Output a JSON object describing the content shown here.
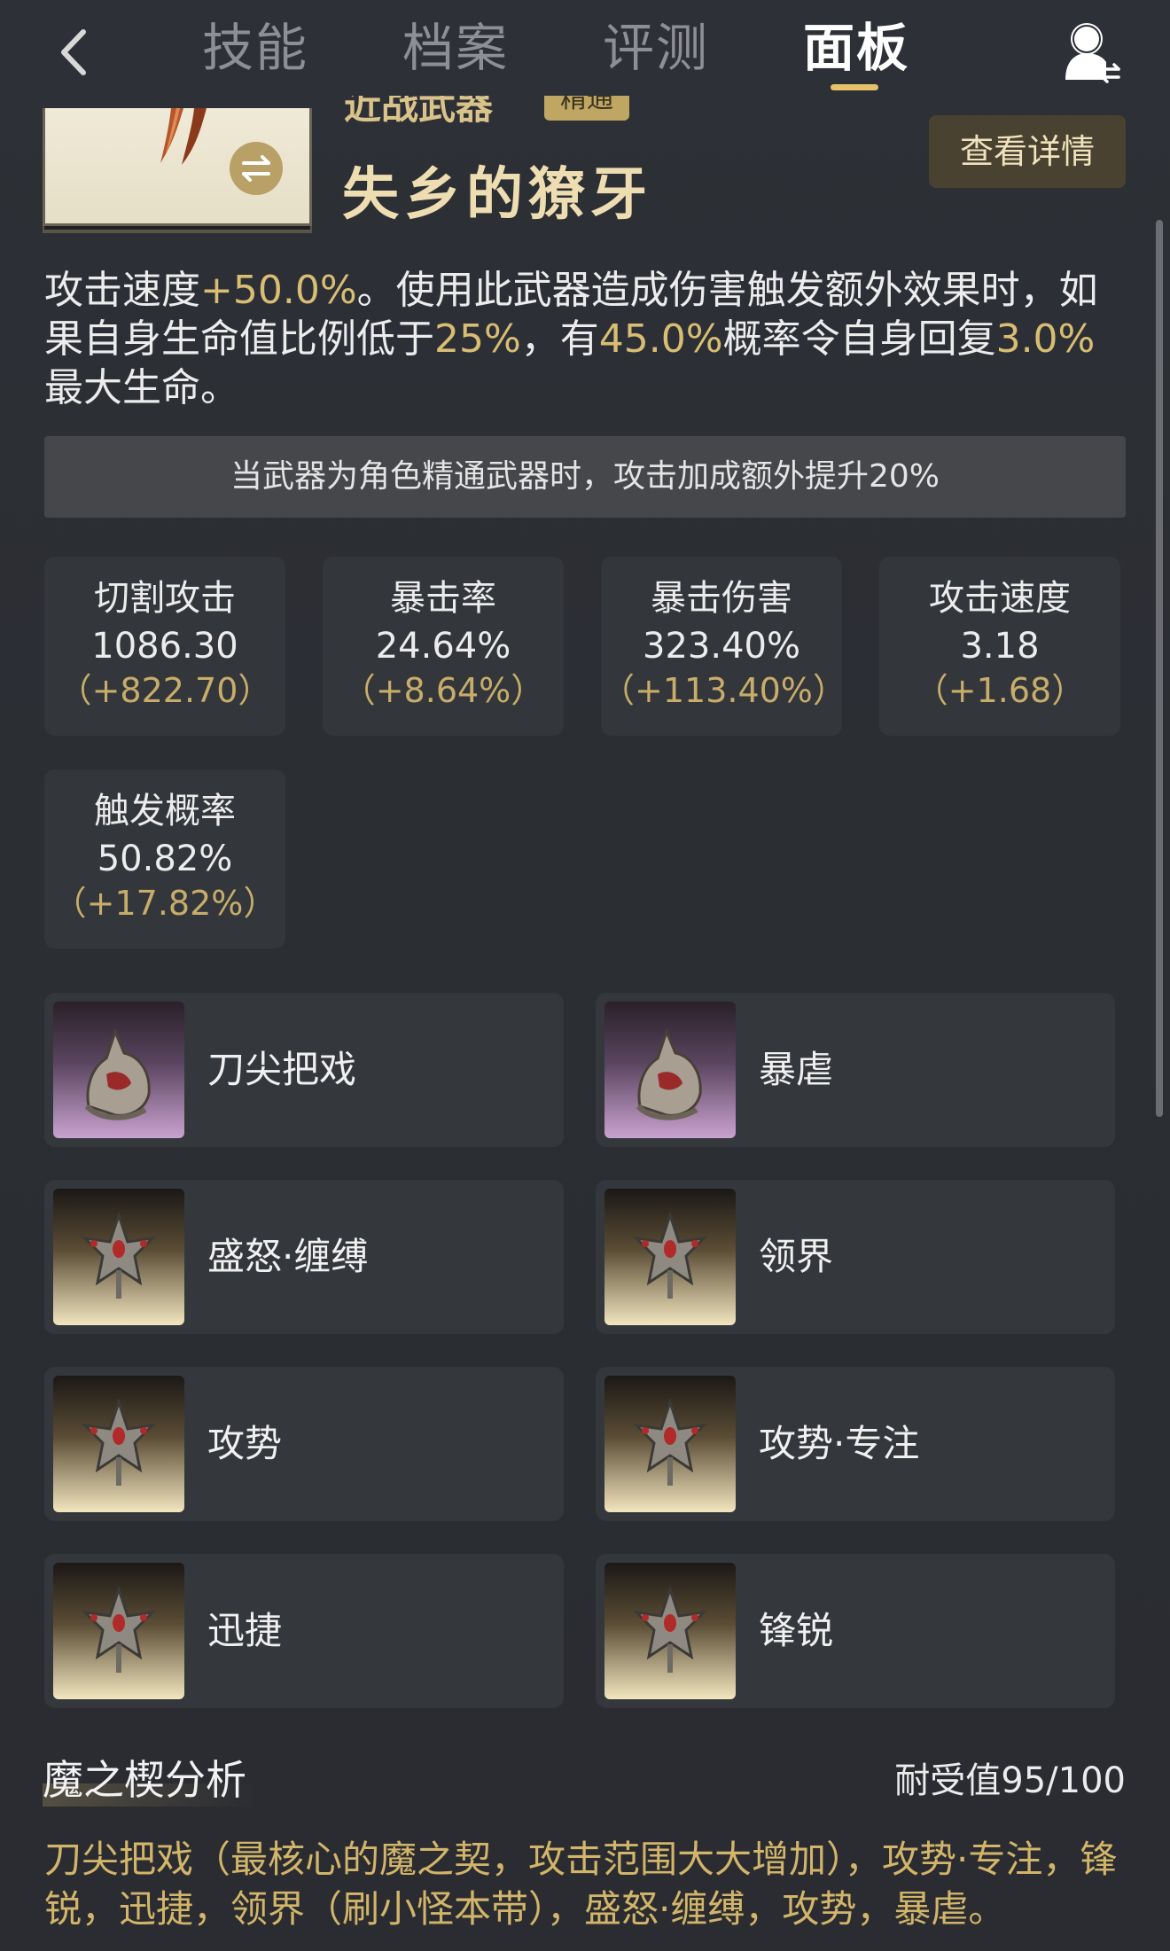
{
  "nav": {
    "tabs": [
      "技能",
      "档案",
      "评测",
      "面板"
    ],
    "active_tab": "面板"
  },
  "weapon": {
    "type": "近战武器",
    "badge": "精通",
    "name": "失乡的獠牙",
    "details_button": "查看详情"
  },
  "description": {
    "p1": "攻击速度",
    "v1": "+50.0%",
    "p2": "。使用此武器造成伤害触发额外效果时，如果自身生命值比例低于",
    "v2": "25%",
    "p3": "，有",
    "v3": "45.0%",
    "p4": "概率令自身回复",
    "v4": "3.0%",
    "p5": "最大生命。"
  },
  "note": "当武器为角色精通武器时，攻击加成额外提升20%",
  "stats": [
    {
      "label": "切割攻击",
      "value": "1086.30",
      "bonus": "（+822.70）"
    },
    {
      "label": "暴击率",
      "value": "24.64%",
      "bonus": "（+8.64%）"
    },
    {
      "label": "暴击伤害",
      "value": "323.40%",
      "bonus": "（+113.40%）"
    },
    {
      "label": "攻击速度",
      "value": "3.18",
      "bonus": "（+1.68）"
    },
    {
      "label": "触发概率",
      "value": "50.82%",
      "bonus": "（+17.82%）"
    }
  ],
  "mods": [
    {
      "name": "刀尖把戏",
      "icon": "wolf-mod-icon"
    },
    {
      "name": "暴虐",
      "icon": "wolf-mod-icon"
    },
    {
      "name": "盛怒·缠缚",
      "icon": "crest-mod-icon"
    },
    {
      "name": "领界",
      "icon": "crest-mod-icon"
    },
    {
      "name": "攻势",
      "icon": "crest-mod-icon"
    },
    {
      "name": "攻势·专注",
      "icon": "crest-mod-icon"
    },
    {
      "name": "迅捷",
      "icon": "crest-mod-icon"
    },
    {
      "name": "锋锐",
      "icon": "crest-mod-icon"
    }
  ],
  "analysis": {
    "title": "魔之楔分析",
    "tolerance": "耐受值95/100",
    "text": "刀尖把戏（最核心的魔之契，攻击范围大大增加），攻势·专注，锋锐，迅捷，领界（刷小怪本带），盛怒·缠缚，攻势，暴虐。"
  },
  "colors": {
    "accent_gold": "#d8bd73",
    "tab_underline": "#e4c16a",
    "background": "#2a2d32"
  }
}
